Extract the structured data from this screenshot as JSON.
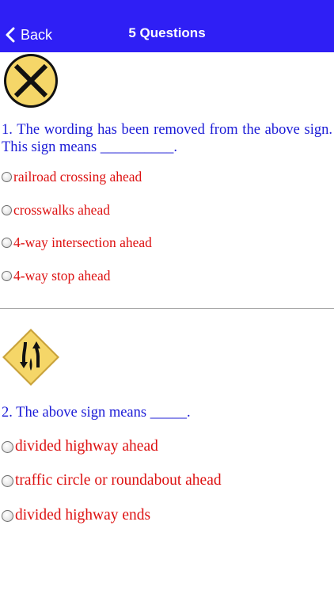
{
  "nav": {
    "back_label": "Back",
    "title": "5 Questions",
    "bar_color": "#2f1ff5"
  },
  "questions": [
    {
      "sign_icon": "railroad-crossing-sign-icon",
      "text": "1. The wording has been removed from the above sign. This sign means __________.",
      "options": [
        "railroad crossing ahead",
        "crosswalks ahead",
        "4-way intersection ahead",
        "4-way stop ahead"
      ]
    },
    {
      "sign_icon": "divided-highway-ends-sign-icon",
      "text": "2. The above sign means _____.",
      "options": [
        "divided highway ahead",
        "traffic circle or roundabout ahead",
        "divided highway ends"
      ]
    }
  ],
  "colors": {
    "question_text": "#1a1ad6",
    "option_text": "#dd1111",
    "sign_yellow": "#f5d668"
  }
}
